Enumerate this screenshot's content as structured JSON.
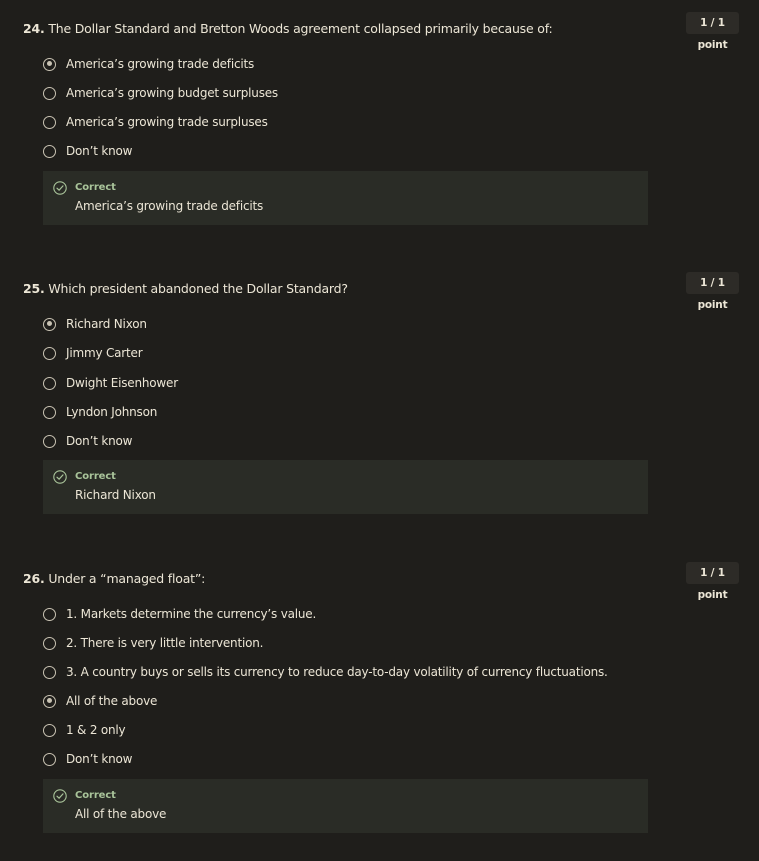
{
  "questions": [
    {
      "number": "24.",
      "text": "The Dollar Standard and Bretton Woods agreement collapsed primarily because of:",
      "points": "1 / 1 point",
      "options": [
        {
          "label": "America’s growing trade deficits",
          "selected": true
        },
        {
          "label": "America’s growing budget surpluses",
          "selected": false
        },
        {
          "label": "America’s growing trade surpluses",
          "selected": false
        },
        {
          "label": "Don’t know",
          "selected": false
        }
      ],
      "feedback": {
        "status": "Correct",
        "answer": "America’s growing trade deficits"
      }
    },
    {
      "number": "25.",
      "text": "Which president abandoned the Dollar Standard?",
      "points": "1 / 1 point",
      "options": [
        {
          "label": "Richard Nixon",
          "selected": true
        },
        {
          "label": "Jimmy Carter",
          "selected": false
        },
        {
          "label": "Dwight Eisenhower",
          "selected": false
        },
        {
          "label": "Lyndon Johnson",
          "selected": false
        },
        {
          "label": "Don’t know",
          "selected": false
        }
      ],
      "feedback": {
        "status": "Correct",
        "answer": "Richard Nixon"
      }
    },
    {
      "number": "26.",
      "text": "Under a “managed float”:",
      "points": "1 / 1 point",
      "options": [
        {
          "label": "1. Markets determine the currency’s value.",
          "selected": false
        },
        {
          "label": "2. There is very little intervention.",
          "selected": false
        },
        {
          "label": "3. A country buys or sells its currency to reduce day-to-day volatility of currency fluctuations.",
          "selected": false
        },
        {
          "label": "All of the above",
          "selected": true
        },
        {
          "label": "1 & 2 only",
          "selected": false
        },
        {
          "label": "Don’t know",
          "selected": false
        }
      ],
      "feedback": {
        "status": "Correct",
        "answer": "All of the above"
      }
    }
  ],
  "colors": {
    "background": "#1f1e1b",
    "text": "#ece6d6",
    "feedback_bg": "#2a2c26",
    "correct_green": "#a9c49a",
    "badge_bg": "#2d2b27"
  },
  "icons": {
    "radio": "radio-button",
    "feedback": "check-circle-icon"
  }
}
